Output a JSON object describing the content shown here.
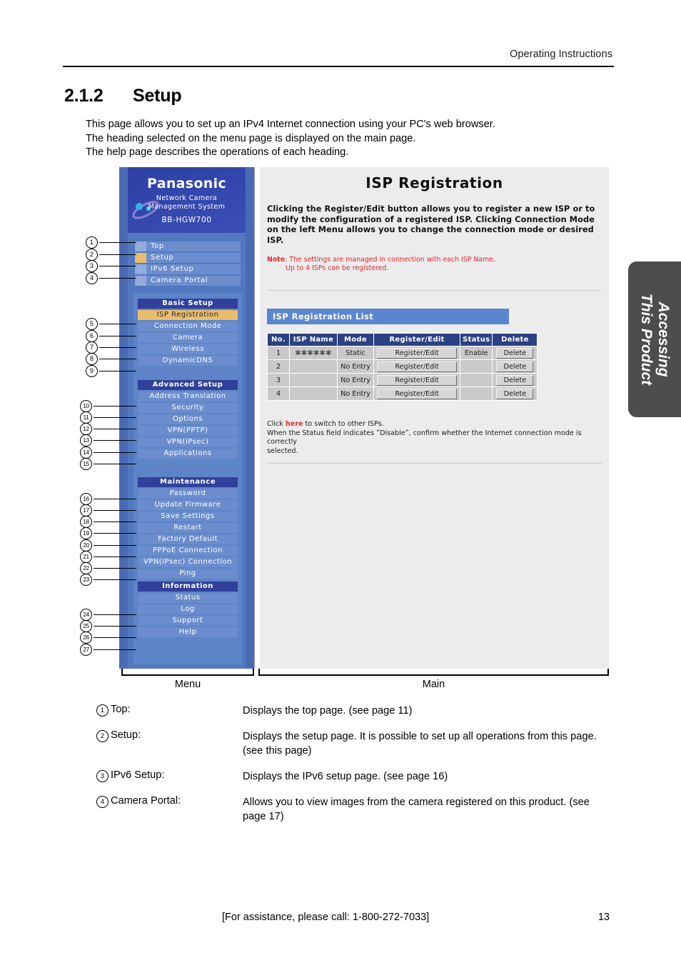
{
  "page": {
    "running_head": "Operating Instructions",
    "section_number": "2.1.2",
    "section_title": "Setup",
    "intro_line1": "This page allows you to set up an IPv4 Internet connection using your PC's web browser.",
    "intro_line2": "The heading selected on the menu page is displayed on the main page.",
    "intro_line3": "The help page describes the operations of each heading.",
    "thumb_tab_line1": "Accessing",
    "thumb_tab_line2": "This Product",
    "footer_assistance": "[For assistance, please call: 1-800-272-7033]",
    "footer_page_number": "13"
  },
  "screenshot": {
    "brand": {
      "logo": "Panasonic",
      "subtitle_line1": "Network Camera",
      "subtitle_line2": "Management System",
      "model": "BB-HGW700"
    },
    "topnav": [
      {
        "label": "Top",
        "selected": false
      },
      {
        "label": "Setup",
        "selected": true
      },
      {
        "label": "IPv6 Setup",
        "selected": false
      },
      {
        "label": "Camera Portal",
        "selected": false
      }
    ],
    "groups": [
      {
        "title": "Basic Setup",
        "items": [
          {
            "label": "ISP Registration",
            "selected": true
          },
          {
            "label": "Connection Mode",
            "selected": false
          },
          {
            "label": "Camera",
            "selected": false
          },
          {
            "label": "Wireless",
            "selected": false
          },
          {
            "label": "DynamicDNS",
            "selected": false
          }
        ]
      },
      {
        "title": "Advanced Setup",
        "items": [
          {
            "label": "Address Translation",
            "selected": false
          },
          {
            "label": "Security",
            "selected": false
          },
          {
            "label": "Options",
            "selected": false
          },
          {
            "label": "VPN(PPTP)",
            "selected": false
          },
          {
            "label": "VPN(IPsec)",
            "selected": false
          },
          {
            "label": "Applications",
            "selected": false
          }
        ]
      },
      {
        "title": "Maintenance",
        "items": [
          {
            "label": "Password",
            "selected": false
          },
          {
            "label": "Update Firmware",
            "selected": false
          },
          {
            "label": "Save Settings",
            "selected": false
          },
          {
            "label": "Restart",
            "selected": false
          },
          {
            "label": "Factory Default",
            "selected": false
          },
          {
            "label": "PPPoE Connection",
            "selected": false
          },
          {
            "label": "VPN(IPsec) Connection",
            "selected": false
          },
          {
            "label": "Ping",
            "selected": false
          }
        ]
      },
      {
        "title": "Information",
        "items": [
          {
            "label": "Status",
            "selected": false
          },
          {
            "label": "Log",
            "selected": false
          },
          {
            "label": "Support",
            "selected": false
          },
          {
            "label": "Help",
            "selected": false
          }
        ]
      }
    ],
    "main": {
      "title": "ISP Registration",
      "description": "Clicking the Register/Edit button allows you to register a new ISP or to modify the configuration of a registered ISP. Clicking Connection Mode on the left Menu allows you to change the connection mode or desired ISP.",
      "note_label": "Note",
      "note_line1": ": The settings are managed in connection with each ISP Name.",
      "note_line2": "Up to 4 ISPs can be registered.",
      "list_banner": "ISP Registration List",
      "table": {
        "headers": [
          "No.",
          "ISP Name",
          "Mode",
          "Register/Edit",
          "Status",
          "Delete"
        ],
        "rows": [
          {
            "no": "1",
            "isp_name": "✻✻✻✻✻✻",
            "mode": "Static",
            "register": "Register/Edit",
            "status": "Enable",
            "delete": "Delete"
          },
          {
            "no": "2",
            "isp_name": "",
            "mode": "No Entry",
            "register": "Register/Edit",
            "status": "",
            "delete": "Delete"
          },
          {
            "no": "3",
            "isp_name": "",
            "mode": "No Entry",
            "register": "Register/Edit",
            "status": "",
            "delete": "Delete"
          },
          {
            "no": "4",
            "isp_name": "",
            "mode": "No Entry",
            "register": "Register/Edit",
            "status": "",
            "delete": "Delete"
          }
        ]
      },
      "post_line1_a": "Click ",
      "post_link": "here",
      "post_line1_b": " to switch to other ISPs.",
      "post_line2": "When the Status field indicates ˮDisableˮ, confirm whether the Internet connection mode is correctly",
      "post_line3": "selected."
    },
    "brace_menu_label": "Menu",
    "brace_main_label": "Main",
    "callouts": [
      "1",
      "2",
      "3",
      "4",
      "5",
      "6",
      "7",
      "8",
      "9",
      "10",
      "11",
      "12",
      "13",
      "14",
      "15",
      "16",
      "17",
      "18",
      "19",
      "20",
      "21",
      "22",
      "23",
      "24",
      "25",
      "26",
      "27"
    ]
  },
  "definitions": [
    {
      "num": "1",
      "term": "Top:",
      "desc": "Displays the top page. (see page 11)"
    },
    {
      "num": "2",
      "term": "Setup:",
      "desc": "Displays the setup page. It is possible to set up all operations from this page. (see this page)"
    },
    {
      "num": "3",
      "term": "IPv6 Setup:",
      "desc": "Displays the IPv6 setup page. (see page 16)"
    },
    {
      "num": "4",
      "term": "Camera Portal:",
      "desc": "Allows you to view images from the camera registered on this product. (see page 17)"
    }
  ],
  "colors": {
    "menu_bg": "#5279bf",
    "menu_outer": "#4a6bb4",
    "brand_blue": "#31409b",
    "item_blue": "#6b8dcd",
    "selected_gold": "#e9bd6c",
    "table_header": "#2c4183",
    "banner_blue": "#5a86cf",
    "note_red": "#e8262a",
    "tab_gray": "#4d4d4d"
  }
}
